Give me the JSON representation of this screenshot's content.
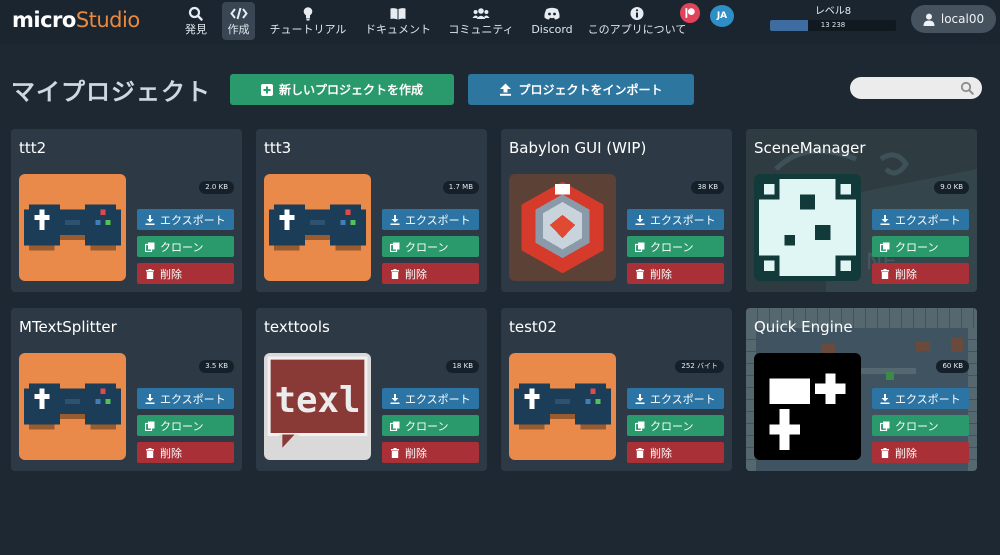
{
  "logo": {
    "bold": "micro",
    "light": "Studio"
  },
  "nav": [
    {
      "key": "explore",
      "label": "発見",
      "icon": "search-icon"
    },
    {
      "key": "create",
      "label": "作成",
      "icon": "code-icon",
      "active": true
    },
    {
      "key": "tutorials",
      "label": "チュートリアル",
      "icon": "lightbulb-icon"
    },
    {
      "key": "docs",
      "label": "ドキュメント",
      "icon": "book-icon"
    },
    {
      "key": "community",
      "label": "コミュニティ",
      "icon": "users-icon"
    },
    {
      "key": "discord",
      "label": "Discord",
      "icon": "discord-icon"
    },
    {
      "key": "about",
      "label": "このアプリについて",
      "icon": "info-icon"
    }
  ],
  "header": {
    "lang": "JA",
    "level_label": "レベル8",
    "level_xp": "13 238",
    "level_progress": 0.3,
    "user": "local00"
  },
  "page": {
    "title": "マイプロジェクト",
    "create_label": "新しいプロジェクトを作成",
    "import_label": "プロジェクトをインポート",
    "search_placeholder": ""
  },
  "actions": {
    "export": "エクスポート",
    "clone": "クローン",
    "delete": "削除"
  },
  "projects": [
    {
      "title": "ttt2",
      "size": "2.0 KB",
      "thumb": "gamepad"
    },
    {
      "title": "ttt3",
      "size": "1.7 MB",
      "thumb": "gamepad"
    },
    {
      "title": "Babylon GUI (WIP)",
      "size": "38 KB",
      "thumb": "babylon"
    },
    {
      "title": "SceneManager",
      "size": "9.0 KB",
      "thumb": "scene"
    },
    {
      "title": "MTextSplitter",
      "size": "3.5 KB",
      "thumb": "gamepad"
    },
    {
      "title": "texttools",
      "size": "18 KB",
      "thumb": "text"
    },
    {
      "title": "test02",
      "size": "252 バイト",
      "thumb": "gamepad"
    },
    {
      "title": "Quick Engine",
      "size": "60 KB",
      "thumb": "quick"
    }
  ],
  "thumb_text": "texl",
  "colors": {
    "accent_orange": "#e9893f",
    "create_green": "#2a9a6c",
    "import_blue": "#2d76a0",
    "delete_red": "#a83036",
    "card_bg": "#2d3a46"
  }
}
